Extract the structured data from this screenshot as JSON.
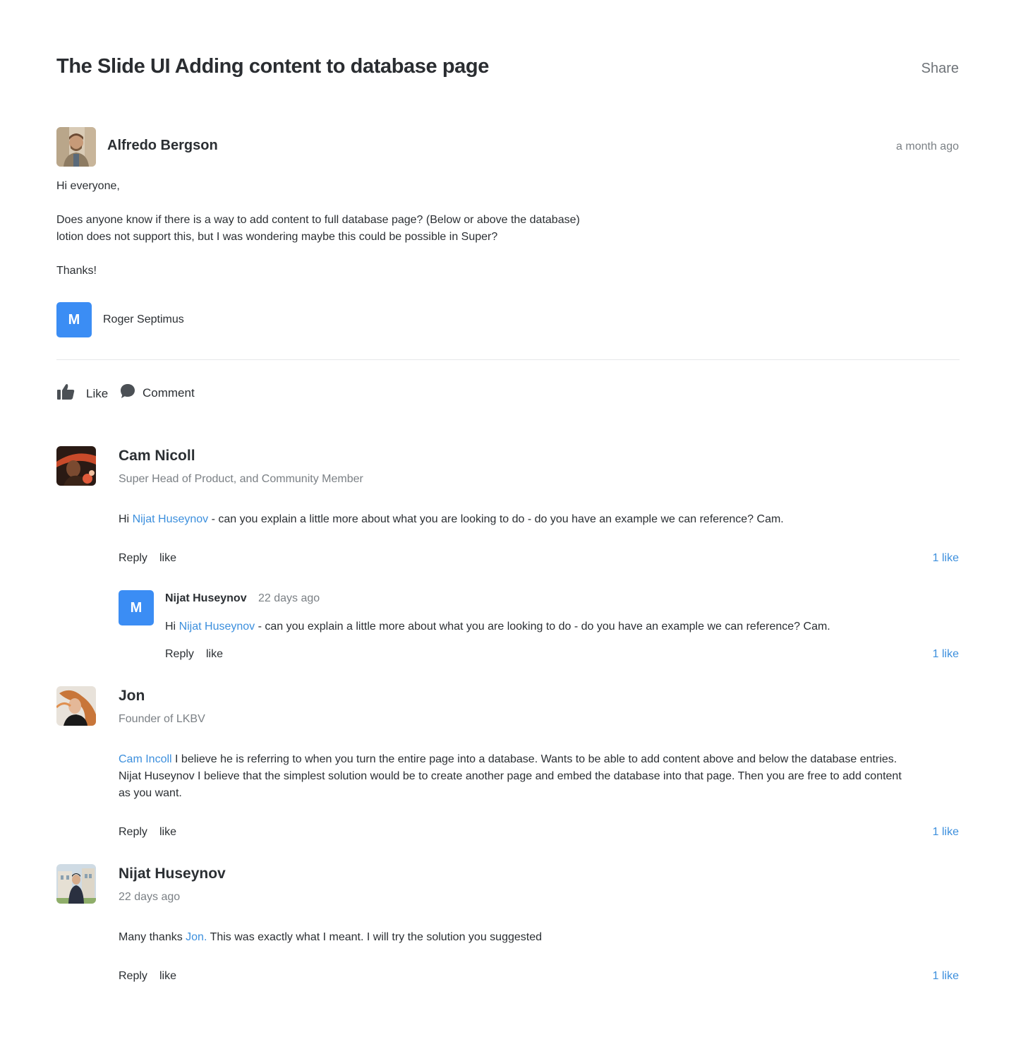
{
  "header": {
    "title": "The Slide UI Adding content to database page",
    "share_label": "Share"
  },
  "post": {
    "author": "Alfredo Bergson",
    "time": "a month ago",
    "greeting": "Hi everyone,",
    "line1": "Does anyone know if there is a way to add content to full database page? (Below or above the database)",
    "line2": "lotion does not support this, but I was wondering maybe this could be possible in Super?",
    "closing": "Thanks!",
    "mention_initial": "M",
    "mention_name": "Roger Septimus"
  },
  "actions": {
    "like_label": "Like",
    "comment_label": "Comment"
  },
  "comments": [
    {
      "name": "Cam Nicoll",
      "subtitle": "Super Head of Product, and Community Member",
      "text_prefix": "Hi ",
      "mention": "Nijat Huseynov",
      "text_suffix": " - can you explain a little more about what you are looking to do - do you have an example we can reference? Cam.",
      "reply_label": "Reply",
      "like_label": "like",
      "likes": "1 like",
      "reply": {
        "initial": "M",
        "name": "Nijat Huseynov",
        "time": "22 days ago",
        "text_prefix": "Hi ",
        "mention": "Nijat Huseynov",
        "text_suffix": " - can you explain a little more about what you are looking to do - do you have an example we can reference? Cam.",
        "reply_label": "Reply",
        "like_label": "like",
        "likes": "1 like"
      }
    },
    {
      "name": "Jon",
      "subtitle": "Founder of LKBV",
      "mention": "Cam Incoll",
      "line1_suffix": " I believe he is referring to when you turn the entire page into a database. Wants to be able to add content above and below the database entries.",
      "line2": "Nijat Huseynov I believe that the simplest solution would be to create another page and embed the database into that page. Then you are free to add content",
      "line3": "as you want.",
      "reply_label": "Reply",
      "like_label": "like",
      "likes": "1 like"
    },
    {
      "name": "Nijat Huseynov",
      "subtitle": "22 days ago",
      "text_prefix": "Many thanks ",
      "mention": "Jon.",
      "text_suffix": " This was exactly what I meant. I will try the solution you suggested",
      "reply_label": "Reply",
      "like_label": "like",
      "likes": "1 like"
    }
  ],
  "icons": {
    "like": "thumbs-up-icon",
    "comment": "speech-bubble-icon"
  },
  "colors": {
    "accent": "#3b8df4",
    "link": "#3c8fdd",
    "muted": "#7b8085",
    "text": "#2b2f33"
  }
}
